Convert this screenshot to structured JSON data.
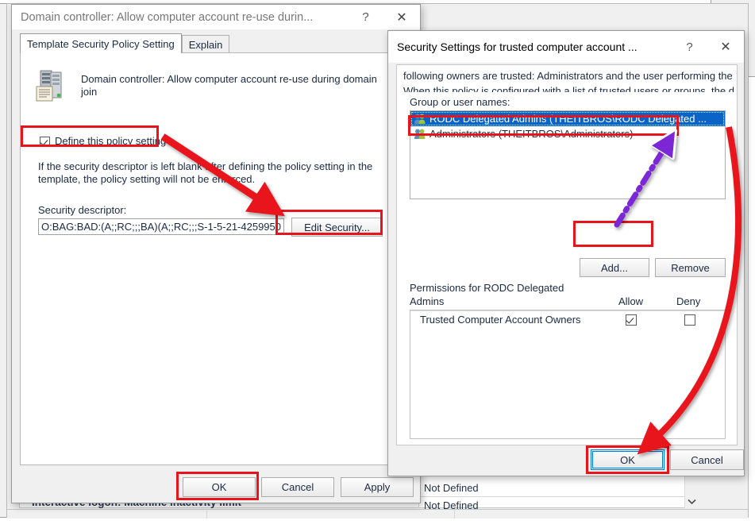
{
  "background": {
    "list_values": [
      "Not Defined",
      "Not Defined"
    ],
    "policy_row_text": "Interactive logon: Machine inactivity limit",
    "scroll_down_icon": "chevron-down-icon"
  },
  "policy_dialog": {
    "title": "Domain controller: Allow computer account re-use durin...",
    "help_button": "?",
    "close_button": "✕",
    "icon": "domain-controller-icon",
    "tabs": [
      {
        "label": "Template Security Policy Setting",
        "active": true
      },
      {
        "label": "Explain",
        "active": false
      }
    ],
    "policy_name": "Domain controller: Allow computer account re-use during domain join",
    "define_checkbox": {
      "label": "Define this policy setting",
      "checked": true
    },
    "hint_text": "If the security descriptor is left blank after defining the policy setting in the template, the policy setting will not be enforced.",
    "descriptor_label": "Security descriptor:",
    "descriptor_value": "O:BAG:BAD:(A;;RC;;;BA)(A;;RC;;;S-1-5-21-4259950",
    "edit_security_button": "Edit Security...",
    "buttons": {
      "ok": "OK",
      "cancel": "Cancel",
      "apply": "Apply"
    }
  },
  "security_dialog": {
    "title": "Security Settings for trusted computer account ...",
    "help_button": "?",
    "close_button": "✕",
    "description_line1": "following owners are trusted: Administrators and the user performing the d",
    "description_line2": "When this policy is configured with a list of trusted users or groups, the d",
    "group_label": "Group or user names:",
    "group_items": [
      {
        "name": "RODC Delegated Admins (THEITBROS\\RODC Delegated ...",
        "selected": true,
        "icon": "group-icon"
      },
      {
        "name": "Administrators (THEITBROS\\Administrators)",
        "selected": false,
        "icon": "group-icon"
      }
    ],
    "add_button": "Add...",
    "remove_button": "Remove",
    "permissions_header_line1": "Permissions for RODC Delegated",
    "permissions_header_line2": "Admins",
    "col_allow": "Allow",
    "col_deny": "Deny",
    "permission_rows": [
      {
        "name": "Trusted Computer Account Owners",
        "allow": true,
        "deny": false
      }
    ],
    "buttons": {
      "ok": "OK",
      "cancel": "Cancel"
    }
  },
  "annotations": {
    "highlight_color": "#e8141b",
    "pointer_color": "#7b27d6",
    "boxes": [
      "define-this-policy-setting",
      "edit-security-button",
      "selected-group-item",
      "add-button",
      "security-dialog-ok-button",
      "policy-dialog-ok-button"
    ],
    "arrows": [
      "define-to-edit-security",
      "edit-security-to-add",
      "add-to-selected-group",
      "security-dialog-to-ok"
    ]
  }
}
